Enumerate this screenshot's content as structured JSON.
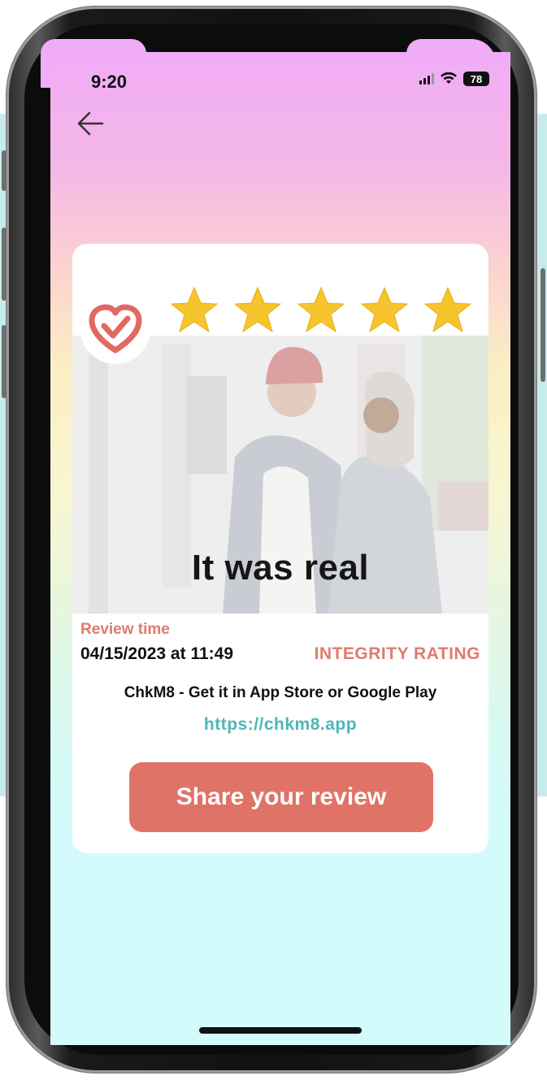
{
  "status_bar": {
    "time": "9:20",
    "battery": "78"
  },
  "header": {
    "back_icon": "arrow-left-icon"
  },
  "review_card": {
    "badge_icon": "heart-check-icon",
    "rating": {
      "value": 5,
      "max": 5
    },
    "headline": "It was real",
    "review_time_label": "Review time",
    "review_time_value": "04/15/2023 at 11:49",
    "integrity_label": "INTEGRITY RATING",
    "promo_text": "ChkM8 - Get it in App Store or Google Play",
    "url": "https://chkm8.app",
    "share_button_label": "Share your review"
  },
  "colors": {
    "accent": "#e07367",
    "link": "#4fb6b6",
    "star": "#f6c52e"
  }
}
